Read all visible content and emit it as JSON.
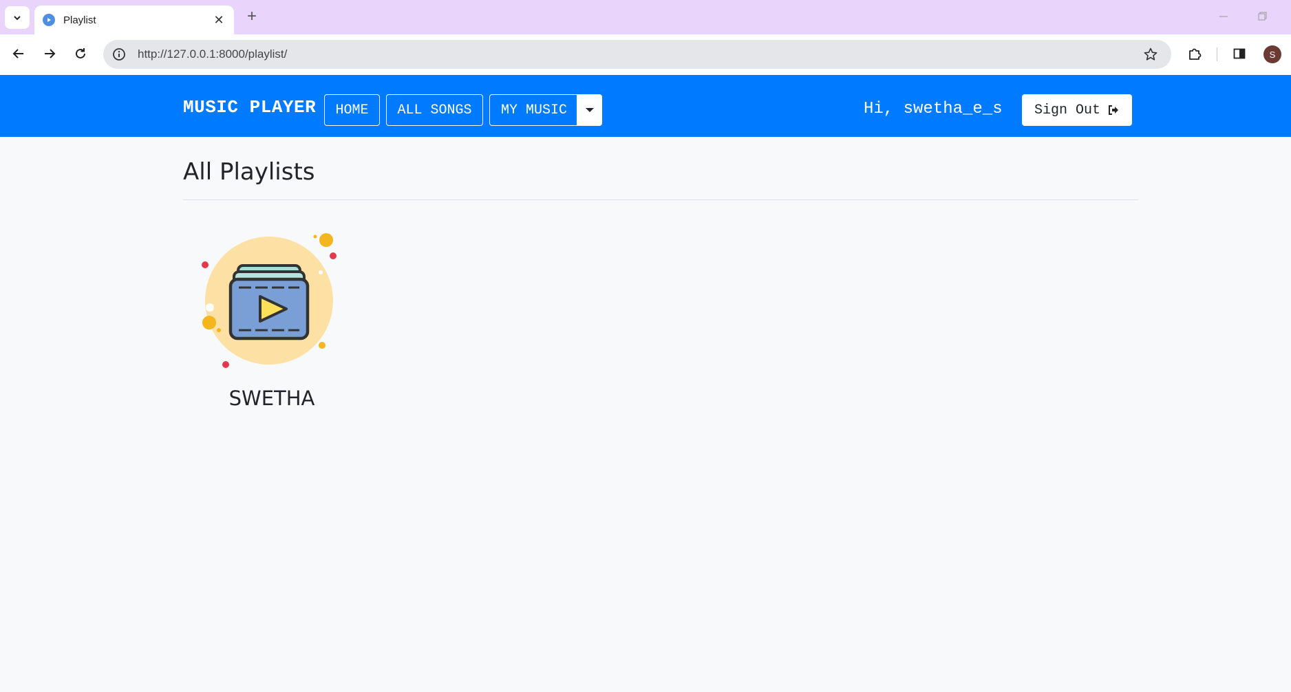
{
  "browser": {
    "tab_title": "Playlist",
    "tab_close": "✕",
    "new_tab": "+",
    "url": "http://127.0.0.1:8000/playlist/",
    "profile_initial": "S"
  },
  "navbar": {
    "brand": "MUSIC PLAYER",
    "links": {
      "home": "HOME",
      "all_songs": "ALL SONGS",
      "my_music": "MY MUSIC"
    },
    "greeting": "Hi, swetha_e_s",
    "sign_out": "Sign Out",
    "accent_color": "#007bff"
  },
  "main": {
    "title": "All Playlists",
    "playlists": [
      {
        "name": "SWETHA",
        "icon": "playlist-video-icon"
      }
    ]
  }
}
